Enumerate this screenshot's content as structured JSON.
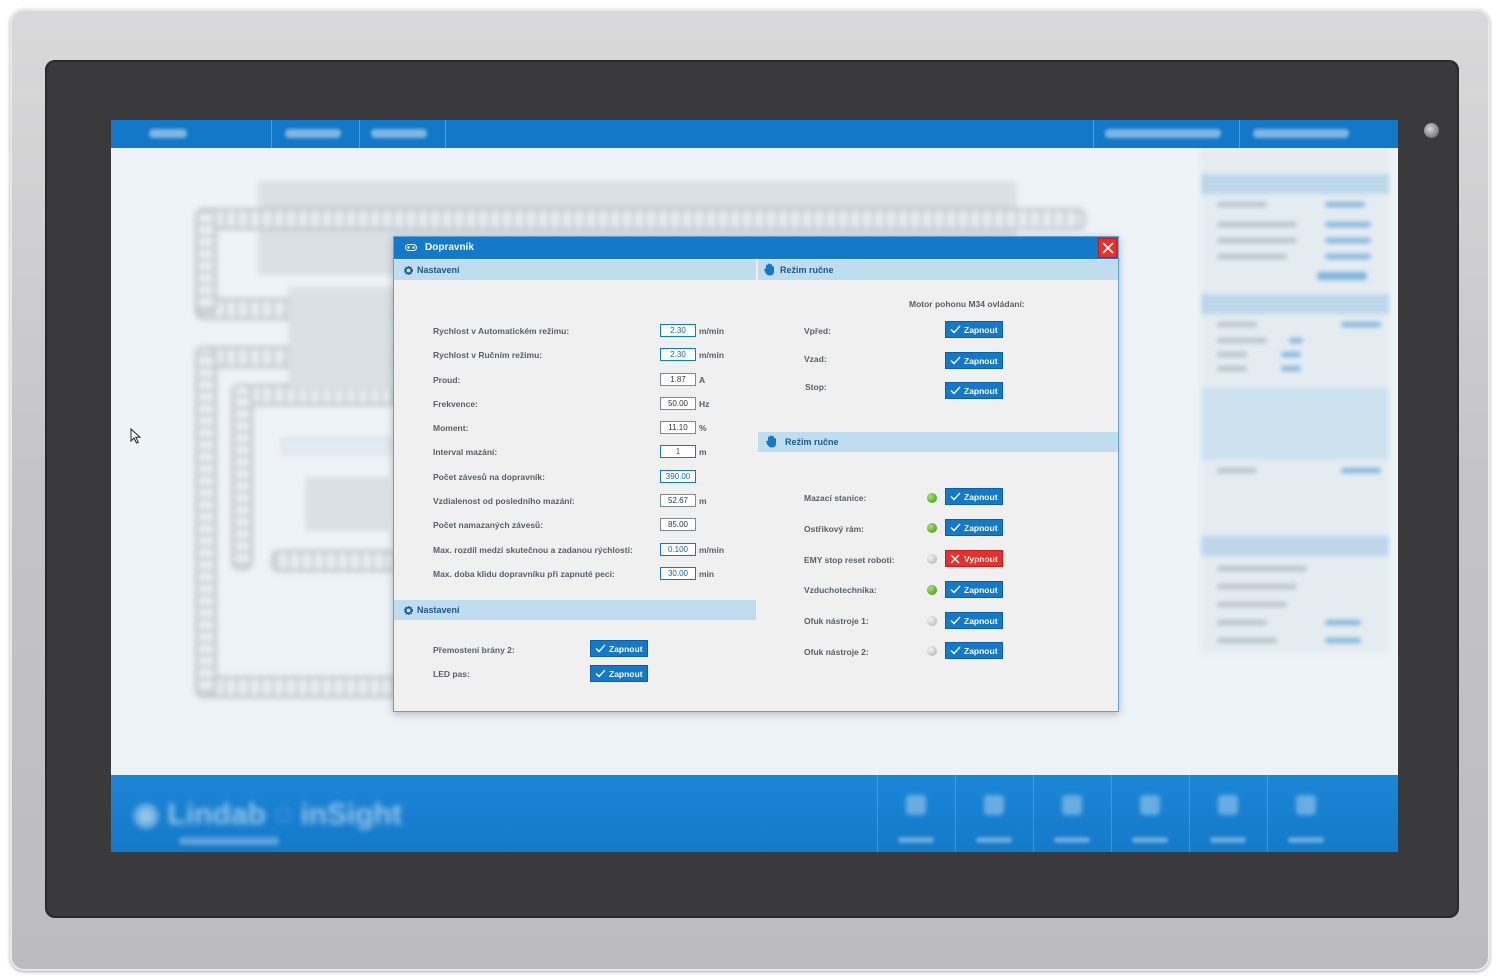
{
  "dialog": {
    "title": "Dopravník",
    "close_icon": "close-icon"
  },
  "left_section": {
    "header": "Nastavení",
    "params": [
      {
        "label": "Rychlost v Automatickém režimu:",
        "value": "2.30",
        "unit": "m/min",
        "editable": true
      },
      {
        "label": "Rychlost v Ručním režimu:",
        "value": "2.30",
        "unit": "m/min",
        "editable": true
      },
      {
        "label": "Proud:",
        "value": "1.87",
        "unit": "A",
        "editable": false
      },
      {
        "label": "Frekvence:",
        "value": "50.00",
        "unit": "Hz",
        "editable": false
      },
      {
        "label": "Moment:",
        "value": "11.10",
        "unit": "%",
        "editable": false
      },
      {
        "label": "Interval mazání:",
        "value": "1",
        "unit": "m",
        "editable": true
      },
      {
        "label": "Počet závesů na dopravník:",
        "value": "390.00",
        "unit": "",
        "editable": true
      },
      {
        "label": "Vzdialenost od posledního mazání:",
        "value": "52.67",
        "unit": "m",
        "editable": false
      },
      {
        "label": "Počet namazaných závesů:",
        "value": "85.00",
        "unit": "",
        "editable": false
      },
      {
        "label": "Max. rozdíl medzi skutečnou a zadanou rýchlostí:",
        "value": "0.100",
        "unit": "m/min",
        "editable": true
      },
      {
        "label": "Max. doba klidu dopravníku při zapnuté peci:",
        "value": "30.00",
        "unit": "min",
        "editable": true
      }
    ]
  },
  "left_section2": {
    "header": "Nastavení",
    "rows": [
      {
        "label": "Přemostení brány 2:",
        "button": "Zapnout"
      },
      {
        "label": "LED pas:",
        "button": "Zapnout"
      }
    ]
  },
  "right_section": {
    "header": "Režim ručne",
    "subtitle": "Motor pohonu M34 ovládaní:",
    "rows": [
      {
        "label": "Vpřed:",
        "button": "Zapnout"
      },
      {
        "label": "Vzad:",
        "button": "Zapnout"
      },
      {
        "label": "Stop:",
        "button": "Zapnout"
      }
    ]
  },
  "right_section2": {
    "header": "Režim ručne",
    "rows": [
      {
        "label": "Mazací stanice:",
        "status": "green",
        "button": "Zapnout",
        "state": "on"
      },
      {
        "label": "Ostřikový rám:",
        "status": "green",
        "button": "Zapnout",
        "state": "on"
      },
      {
        "label": "EMY stop reset roboti:",
        "status": "gray",
        "button": "Vypnout",
        "state": "off"
      },
      {
        "label": "Vzduchotechnika:",
        "status": "green",
        "button": "Zapnout",
        "state": "on"
      },
      {
        "label": "Ofuk nástroje 1:",
        "status": "gray",
        "button": "Zapnout",
        "state": "on"
      },
      {
        "label": "Ofuk nástroje 2:",
        "status": "gray",
        "button": "Zapnout",
        "state": "on"
      }
    ]
  },
  "colors": {
    "accent": "#1479c9",
    "section_header": "#c0dcef",
    "status_on": "#62b32f",
    "status_off": "#c9c9c9",
    "danger": "#e7302b"
  }
}
